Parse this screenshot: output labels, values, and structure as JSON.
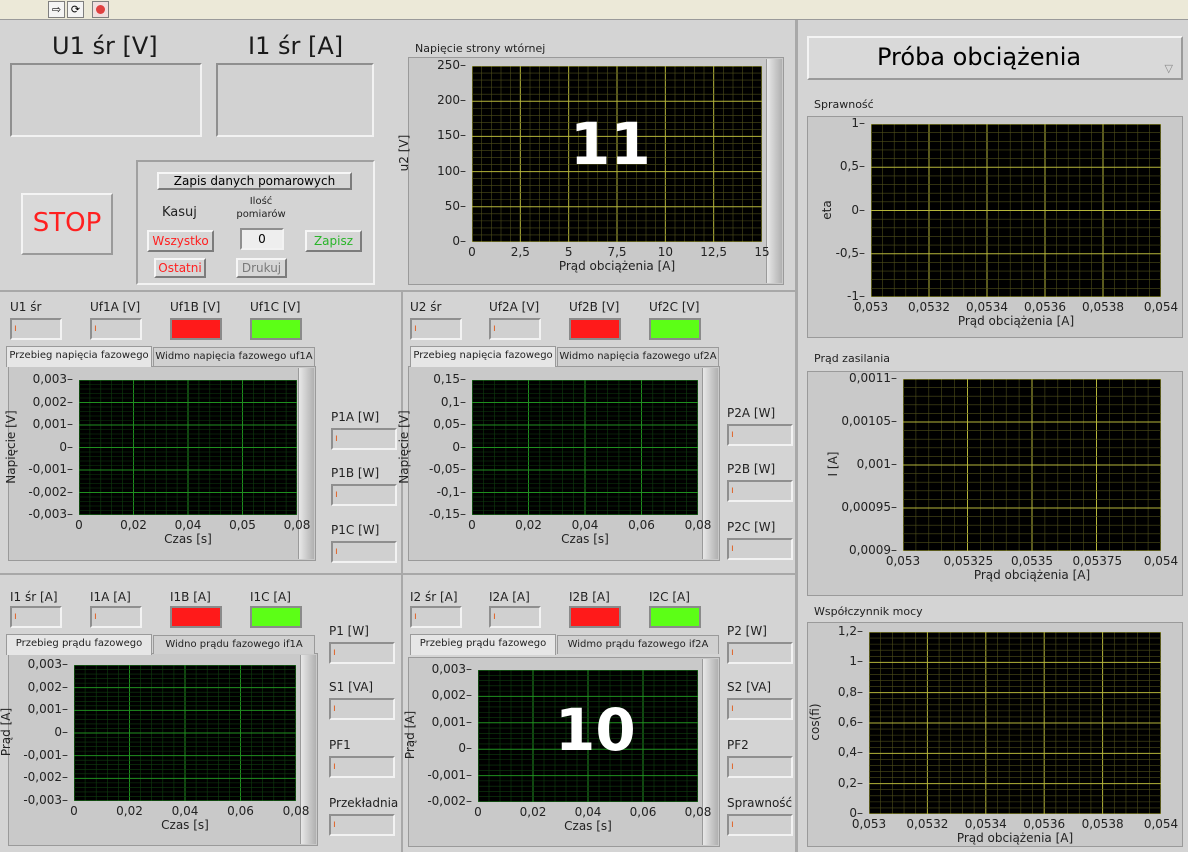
{
  "toolbar": {
    "run_icon": "run-arrow-icon",
    "run_cont_icon": "run-continuously-icon",
    "abort_icon": "abort-icon"
  },
  "top": {
    "u1_label": "U1 śr [V]",
    "i1_label": "I1 śr [A]",
    "stop_label": "STOP"
  },
  "recording": {
    "title": "Zapis danych pomarowych",
    "clear_label": "Kasuj",
    "count_label": "Ilość pomiarów",
    "all_label": "Wszystko",
    "last_label": "Ostatni",
    "count_value": "0",
    "print_label": "Drukuj",
    "save_label": "Zapisz"
  },
  "mode_selector": "Próba obciążenia",
  "overlays": {
    "upper": "11",
    "lower": "10"
  },
  "left_block1": {
    "labels": [
      "U1 śr",
      "Uf1A [V]",
      "Uf1B [V]",
      "Uf1C [V]"
    ],
    "tabs": [
      "Przebieg napięcia fazowego",
      "Widmo napięcia fazowego uf1A"
    ],
    "power_labels": [
      "P1A [W]",
      "P1B [W]",
      "P1C [W]"
    ]
  },
  "right_block1": {
    "labels": [
      "U2 śr",
      "Uf2A [V]",
      "Uf2B [V]",
      "Uf2C [V]"
    ],
    "tabs": [
      "Przebieg napięcia fazowego",
      "Widmo napięcia fazowego uf2A"
    ],
    "power_labels": [
      "P2A [W]",
      "P2B [W]",
      "P2C [W]"
    ]
  },
  "left_block2": {
    "labels": [
      "I1 śr [A]",
      "I1A [A]",
      "I1B [A]",
      "I1C [A]"
    ],
    "tabs": [
      "Przebieg prądu fazowego",
      "Widno prądu fazowego if1A"
    ],
    "power_labels": [
      "P1 [W]",
      "S1 [VA]",
      "PF1",
      "Przekładnia"
    ]
  },
  "right_block2": {
    "labels": [
      "I2 śr [A]",
      "I2A [A]",
      "I2B [A]",
      "I2C [A]"
    ],
    "tabs": [
      "Przebieg prądu fazowego",
      "Widmo prądu fazowego if2A"
    ],
    "power_labels": [
      "P2 [W]",
      "S2 [VA]",
      "PF2",
      "Sprawność"
    ]
  },
  "charts": {
    "u2": {
      "title": "Napięcie strony wtórnej",
      "xlabel": "Prąd obciążenia [A]",
      "ylabel": "u2 [V]",
      "xticks": [
        "0",
        "2,5",
        "5",
        "7,5",
        "10",
        "12,5",
        "15"
      ],
      "yticks": [
        "250",
        "200",
        "150",
        "100",
        "50",
        "0"
      ]
    },
    "ua": {
      "xlabel": "Czas [s]",
      "ylabel": "Napięcie [V]",
      "xticks": [
        "0",
        "0,02",
        "0,04",
        "0,05",
        "0,08"
      ],
      "yticks": [
        "0,003",
        "0,002",
        "0,001",
        "0",
        "-0,001",
        "-0,002",
        "-0,003"
      ]
    },
    "ub": {
      "xlabel": "Czas [s]",
      "ylabel": "Napięcie [V]",
      "xticks": [
        "0",
        "0,02",
        "0,04",
        "0,06",
        "0,08"
      ],
      "yticks": [
        "0,15",
        "0,1",
        "0,05",
        "0",
        "-0,05",
        "-0,1",
        "-0,15"
      ]
    },
    "ia": {
      "xlabel": "Czas [s]",
      "ylabel": "Prąd [A]",
      "xticks": [
        "0",
        "0,02",
        "0,04",
        "0,06",
        "0,08"
      ],
      "yticks": [
        "0,003",
        "0,002",
        "0,001",
        "0",
        "-0,001",
        "-0,002",
        "-0,003"
      ]
    },
    "ib": {
      "xlabel": "Czas [s]",
      "ylabel": "Prąd [A]",
      "xticks": [
        "0",
        "0,02",
        "0,04",
        "0,06",
        "0,08"
      ],
      "yticks": [
        "0,003",
        "0,002",
        "0,001",
        "0",
        "-0,001",
        "-0,002"
      ]
    },
    "eta": {
      "title": "Sprawność",
      "xlabel": "Prąd obciążenia [A]",
      "ylabel": "eta",
      "xticks": [
        "0,053",
        "0,0532",
        "0,0534",
        "0,0536",
        "0,0538",
        "0,054"
      ],
      "yticks": [
        "1",
        "0,5",
        "0",
        "-0,5",
        "-1"
      ]
    },
    "current": {
      "title": "Prąd zasilania",
      "xlabel": "Prąd obciążenia [A]",
      "ylabel": "I [A]",
      "xticks": [
        "0,053",
        "0,05325",
        "0,0535",
        "0,05375",
        "0,054"
      ],
      "yticks": [
        "0,0011",
        "0,00105",
        "0,001",
        "0,00095",
        "0,0009"
      ]
    },
    "pf": {
      "title": "Współczynnik mocy",
      "xlabel": "Prąd obciążenia [A]",
      "ylabel": "cos(fi)",
      "xticks": [
        "0,053",
        "0,0532",
        "0,0534",
        "0,0536",
        "0,0538",
        "0,054"
      ],
      "yticks": [
        "1,2",
        "1",
        "0,8",
        "0,6",
        "0,4",
        "0,2",
        "0"
      ]
    }
  },
  "colors": {
    "plot_bg": "#000000",
    "grid_green": "#1f8f1f",
    "grid_yellow": "#b5b53a",
    "led_red": "#ff1a1a",
    "led_green": "#5cff16",
    "stop_red": "#ff2020"
  }
}
